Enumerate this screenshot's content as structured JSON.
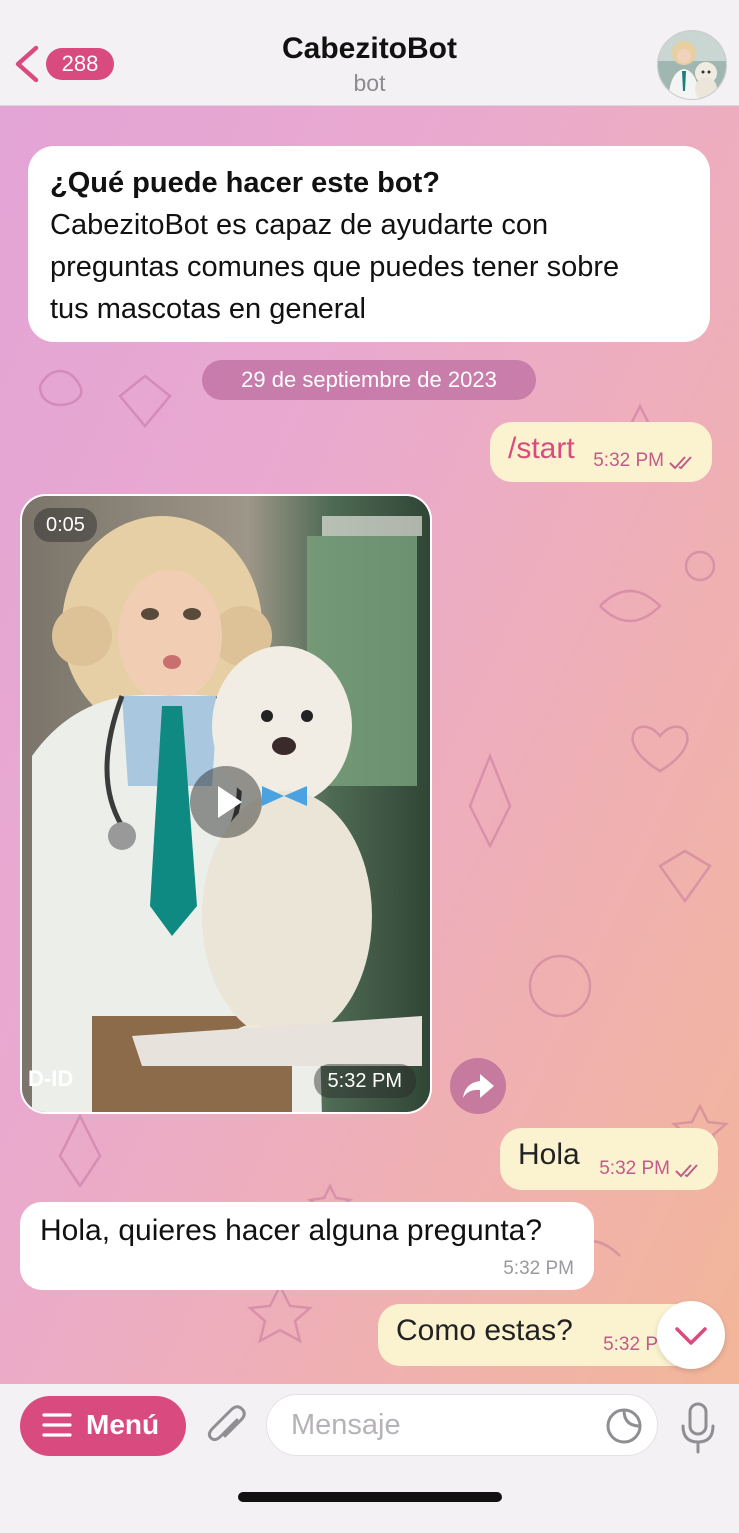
{
  "header": {
    "unread_count": "288",
    "title": "CabezitoBot",
    "subtitle": "bot"
  },
  "info_card": {
    "question": "¿Qué puede hacer este bot?",
    "line1": "CabezitoBot es capaz de ayudarte con",
    "line2": "preguntas comunes que puedes tener sobre",
    "line3": "tus mascotas en general"
  },
  "date_separator": "29 de septiembre de 2023",
  "messages": [
    {
      "dir": "out",
      "text": "/start",
      "time": "5:32 PM"
    },
    {
      "dir": "in",
      "type": "video",
      "duration": "0:05",
      "time": "5:32 PM",
      "watermark": "D-ID"
    },
    {
      "dir": "out",
      "text": "Hola",
      "time": "5:32 PM"
    },
    {
      "dir": "in",
      "text": "Hola, quieres hacer alguna pregunta?",
      "time": "5:32 PM"
    },
    {
      "dir": "out",
      "text": "Como estas?",
      "time": "5:32 P"
    }
  ],
  "composer": {
    "menu_label": "Menú",
    "placeholder": "Mensaje"
  },
  "colors": {
    "accent": "#d94b7e",
    "outgoing_bubble": "#fbf3d0",
    "incoming_bubble": "#ffffff"
  }
}
